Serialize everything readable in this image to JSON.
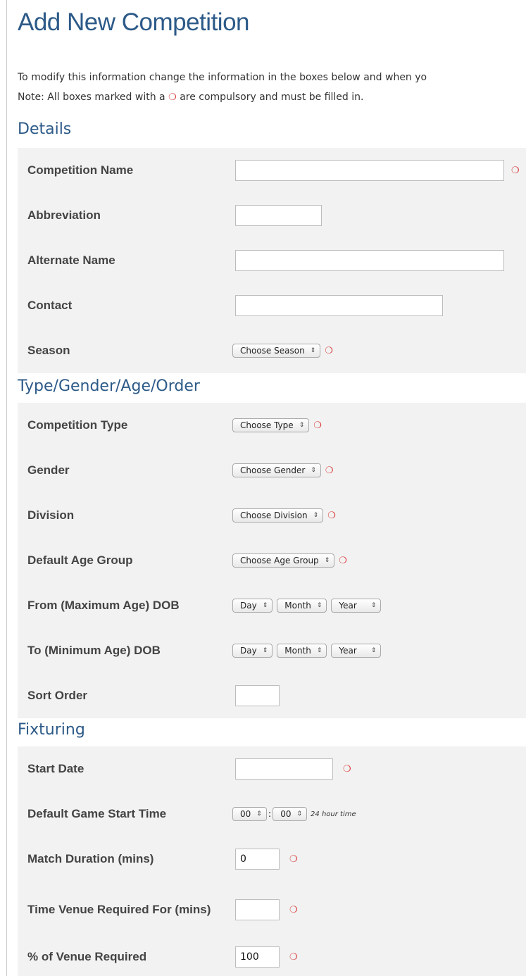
{
  "page": {
    "title": "Add New Competition",
    "intro_line1": "To modify this information change the information in the boxes below and when yo",
    "intro_line2_a": "Note: All boxes marked with a",
    "intro_line2_b": "are compulsory and must be filled in.",
    "required_marker": "❍"
  },
  "sections": {
    "details": "Details",
    "type": "Type/Gender/Age/Order",
    "fixturing": "Fixturing"
  },
  "details": {
    "competition_name": {
      "label": "Competition Name",
      "value": ""
    },
    "abbreviation": {
      "label": "Abbreviation",
      "value": ""
    },
    "alternate_name": {
      "label": "Alternate Name",
      "value": ""
    },
    "contact": {
      "label": "Contact",
      "value": ""
    },
    "season": {
      "label": "Season",
      "selected": "Choose Season"
    }
  },
  "type": {
    "competition_type": {
      "label": "Competition Type",
      "selected": "Choose Type"
    },
    "gender": {
      "label": "Gender",
      "selected": "Choose Gender"
    },
    "division": {
      "label": "Division",
      "selected": "Choose Division"
    },
    "age_group": {
      "label": "Default Age Group",
      "selected": "Choose Age Group"
    },
    "from_dob": {
      "label": "From (Maximum Age) DOB",
      "day": "Day",
      "month": "Month",
      "year": "Year"
    },
    "to_dob": {
      "label": "To (Minimum Age) DOB",
      "day": "Day",
      "month": "Month",
      "year": "Year"
    },
    "sort_order": {
      "label": "Sort Order",
      "value": ""
    }
  },
  "fixturing": {
    "start_date": {
      "label": "Start Date",
      "value": ""
    },
    "start_time": {
      "label": "Default Game Start Time",
      "hour": "00",
      "minute": "00",
      "separator": ":",
      "hint": "24 hour time"
    },
    "match_duration": {
      "label": "Match Duration (mins)",
      "value": "0"
    },
    "venue_time": {
      "label": "Time Venue Required For (mins)",
      "value": ""
    },
    "venue_percent": {
      "label": "% of Venue Required",
      "value": "100"
    }
  },
  "icons": {
    "select_arrows": "⇕"
  },
  "colors": {
    "heading": "#2c5a88",
    "required": "#d93a3a",
    "row_bg": "#f2f2f2"
  }
}
